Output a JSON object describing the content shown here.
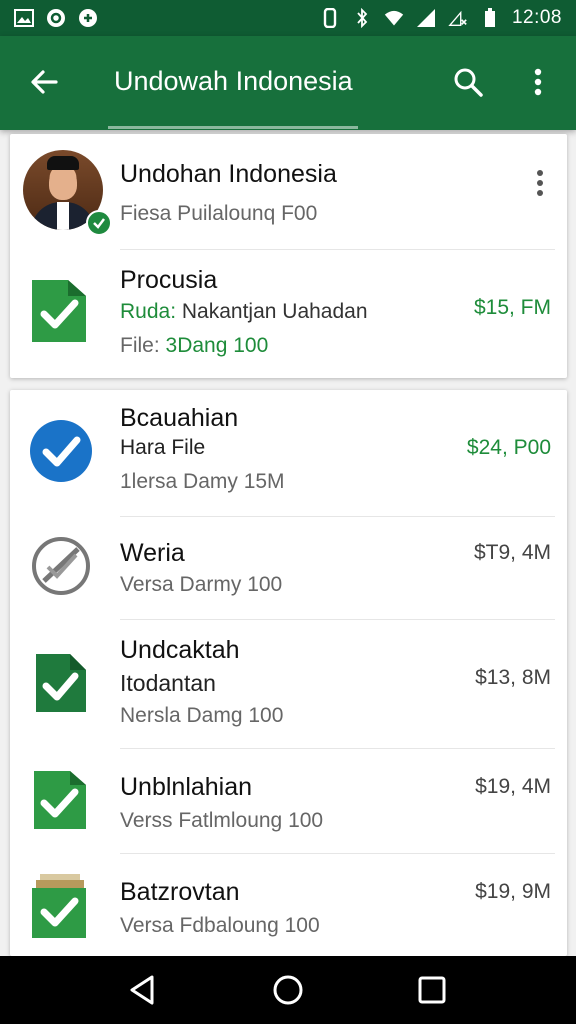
{
  "status_bar": {
    "left_icons": [
      "gallery-icon",
      "at-icon",
      "game-icon"
    ],
    "right_icons": [
      "vibrate-icon",
      "bluetooth-icon",
      "wifi-icon",
      "signal-icon",
      "no-signal-icon",
      "battery-icon"
    ],
    "time": "12:08"
  },
  "app_bar": {
    "title": "Undowah Indonesia",
    "back_icon": "back-arrow-icon",
    "search_icon": "search-icon",
    "more_icon": "more-vert-icon"
  },
  "profile": {
    "name": "Undohan Indonesia",
    "subtitle": "Fiesa Puilalounq F00"
  },
  "featured_item": {
    "title": "Procusia",
    "desc_prefix": "Ruda:",
    "desc_rest": " Nakantjan Uahadan",
    "file_prefix": "File:",
    "file_value": " 3Dang 100",
    "price": "$15, FM"
  },
  "items": [
    {
      "title": "Bcauahian",
      "line2": "Hara File",
      "meta": "1lersa Damy 15M",
      "price": "$24, P00",
      "icon": "blue-check-circle-icon",
      "price_green": true
    },
    {
      "title": "Weria",
      "line2": "",
      "meta": "Versa Darmy 100",
      "price": "$T9, 4M",
      "icon": "blocked-circle-icon",
      "price_green": false
    },
    {
      "title": "Undcaktah",
      "line2": "Itodantan",
      "meta": "Nersla Damg 100",
      "price": "$13, 8M",
      "icon": "green-file-check-icon",
      "price_green": false
    },
    {
      "title": "Unblnlahian",
      "line2": "",
      "meta": "Verss Fatlmloung 100",
      "price": "$19, 4M",
      "icon": "green-file-check-icon",
      "price_green": false
    },
    {
      "title": "Batzrovtan",
      "line2": "",
      "meta": "Versa Fdbaloung 100",
      "price": "$19, 9M",
      "icon": "folder-check-icon",
      "price_green": false
    }
  ],
  "nav_bar": {
    "back": "nav-back-icon",
    "home": "nav-home-icon",
    "recents": "nav-recents-icon"
  },
  "colors": {
    "status_bar": "#0f5c33",
    "app_bar": "#17703c",
    "accent_green": "#1e8c3a",
    "blue": "#1a73c8"
  }
}
